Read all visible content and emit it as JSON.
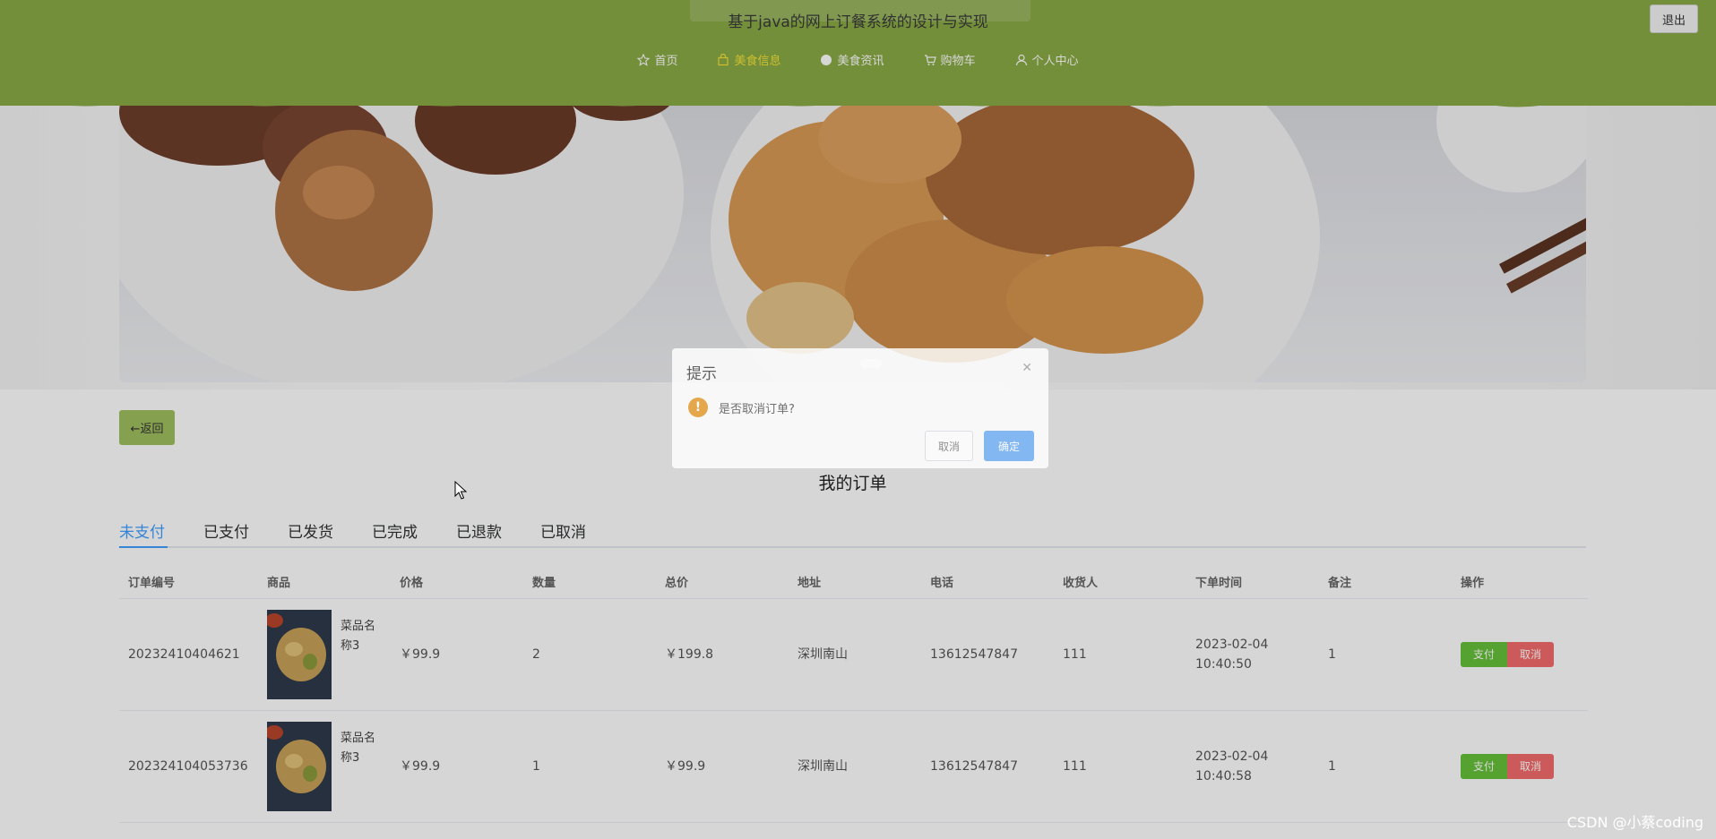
{
  "header": {
    "site_title": "基于java的网上订餐系统的设计与实现",
    "logout_label": "退出",
    "brand_color": "#8bab46",
    "nav": [
      {
        "label": "首页",
        "icon": "star-icon"
      },
      {
        "label": "美食信息",
        "icon": "bag-icon",
        "active": true
      },
      {
        "label": "美食资讯",
        "icon": "circle-icon"
      },
      {
        "label": "购物车",
        "icon": "cart-icon"
      },
      {
        "label": "个人中心",
        "icon": "user-icon"
      }
    ]
  },
  "back_label": "←返回",
  "page_heading": "我的订单",
  "tabs": [
    {
      "label": "未支付",
      "active": true
    },
    {
      "label": "已支付"
    },
    {
      "label": "已发货"
    },
    {
      "label": "已完成"
    },
    {
      "label": "已退款"
    },
    {
      "label": "已取消"
    }
  ],
  "table": {
    "columns": [
      "订单编号",
      "商品",
      "价格",
      "数量",
      "总价",
      "地址",
      "电话",
      "收货人",
      "下单时间",
      "备注",
      "操作"
    ],
    "rows": [
      {
        "order_no": "20232410404621",
        "goods": "菜品名称3",
        "price": "￥99.9",
        "qty": "2",
        "total": "￥199.8",
        "address": "深圳南山",
        "phone": "13612547847",
        "receiver": "111",
        "time": "2023-02-04 10:40:50",
        "note": "1",
        "pay": "支付",
        "cancel": "取消"
      },
      {
        "order_no": "202324104053736",
        "goods": "菜品名称3",
        "price": "￥99.9",
        "qty": "1",
        "total": "￥99.9",
        "address": "深圳南山",
        "phone": "13612547847",
        "receiver": "111",
        "time": "2023-02-04 10:40:58",
        "note": "1",
        "pay": "支付",
        "cancel": "取消"
      }
    ]
  },
  "dialog": {
    "title": "提示",
    "message": "是否取消订单?",
    "cancel_label": "取消",
    "confirm_label": "确定",
    "warning_color": "#e6a23c",
    "confirm_color": "#79b4f6"
  },
  "watermark": "CSDN @小蔡coding"
}
